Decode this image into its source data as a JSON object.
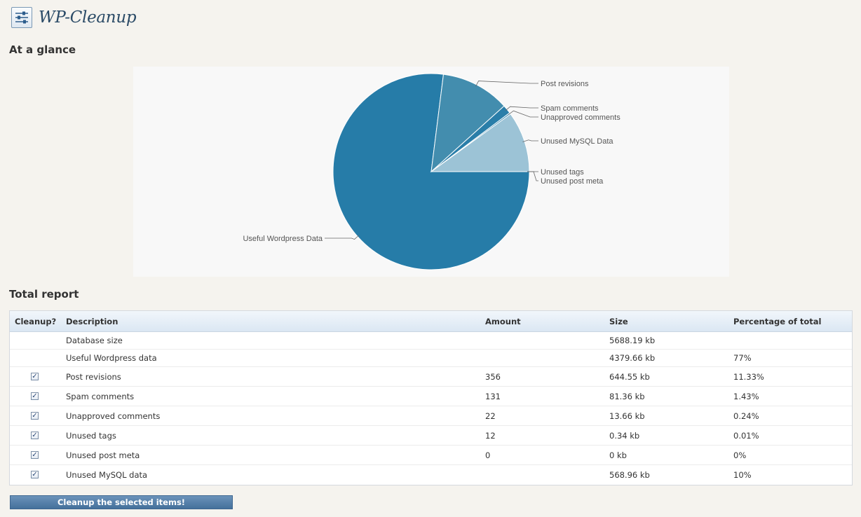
{
  "app": {
    "title": "WP-Cleanup"
  },
  "sections": {
    "glance": "At a glance",
    "report": "Total report"
  },
  "chart_data": {
    "type": "pie",
    "slices": [
      {
        "label": "Useful Wordpress Data",
        "value": 77,
        "color": "#267ca8"
      },
      {
        "label": "Post revisions",
        "value": 11.33,
        "color": "#438dae"
      },
      {
        "label": "Spam comments",
        "value": 1.43,
        "color": "#2a7ea9"
      },
      {
        "label": "Unapproved comments",
        "value": 0.24,
        "color": "#2a7ea9"
      },
      {
        "label": "Unused MySQL Data",
        "value": 10,
        "color": "#9cc3d6"
      },
      {
        "label": "Unused tags",
        "value": 0.01,
        "color": "#9cc3d6"
      },
      {
        "label": "Unused post meta",
        "value": 0,
        "color": "#9cc3d6"
      }
    ]
  },
  "table": {
    "headers": [
      "Cleanup?",
      "Description",
      "Amount",
      "Size",
      "Percentage of total"
    ],
    "rows": [
      {
        "checkbox": false,
        "description": "Database size",
        "amount": "",
        "size": "5688.19 kb",
        "percentage": ""
      },
      {
        "checkbox": false,
        "description": "Useful Wordpress data",
        "amount": "",
        "size": "4379.66 kb",
        "percentage": "77%"
      },
      {
        "checkbox": true,
        "checked": true,
        "description": "Post revisions",
        "amount": "356",
        "size": "644.55 kb",
        "percentage": "11.33%"
      },
      {
        "checkbox": true,
        "checked": true,
        "description": "Spam comments",
        "amount": "131",
        "size": "81.36 kb",
        "percentage": "1.43%"
      },
      {
        "checkbox": true,
        "checked": true,
        "description": "Unapproved comments",
        "amount": "22",
        "size": "13.66 kb",
        "percentage": "0.24%"
      },
      {
        "checkbox": true,
        "checked": true,
        "description": "Unused tags",
        "amount": "12",
        "size": "0.34 kb",
        "percentage": "0.01%"
      },
      {
        "checkbox": true,
        "checked": true,
        "description": "Unused post meta",
        "amount": "0",
        "size": "0 kb",
        "percentage": "0%"
      },
      {
        "checkbox": true,
        "checked": true,
        "description": "Unused MySQL data",
        "amount": "",
        "size": "568.96 kb",
        "percentage": "10%"
      }
    ]
  },
  "button": {
    "label": "Cleanup the selected items!"
  }
}
